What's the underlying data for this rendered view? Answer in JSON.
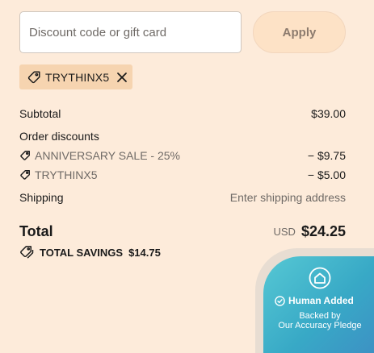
{
  "discount": {
    "placeholder": "Discount code or gift card",
    "value": "",
    "apply_label": "Apply"
  },
  "applied_code": {
    "code": "TRYTHINX5",
    "icon": "tag-icon",
    "remove_icon": "close-icon"
  },
  "summary": {
    "subtotal_label": "Subtotal",
    "subtotal_value": "$39.00",
    "order_discounts_label": "Order discounts",
    "discounts": [
      {
        "name": "ANNIVERSARY SALE - 25%",
        "amount": "− $9.75"
      },
      {
        "name": "TRYTHINX5",
        "amount": "− $5.00"
      }
    ],
    "shipping_label": "Shipping",
    "shipping_value": "Enter shipping address",
    "total_label": "Total",
    "total_currency": "USD",
    "total_value": "$24.25",
    "savings_label": "TOTAL SAVINGS",
    "savings_value": "$14.75"
  },
  "badge": {
    "title": "Human Added",
    "line1": "Backed by",
    "line2": "Our Accuracy Pledge",
    "icon": "home-icon",
    "check_icon": "check-circle-icon"
  },
  "colors": {
    "background": "#fdebda",
    "chip": "#f6d4b0",
    "apply_button": "#fde2c6",
    "badge_start": "#56c8d4",
    "badge_end": "#3d8fc4"
  }
}
